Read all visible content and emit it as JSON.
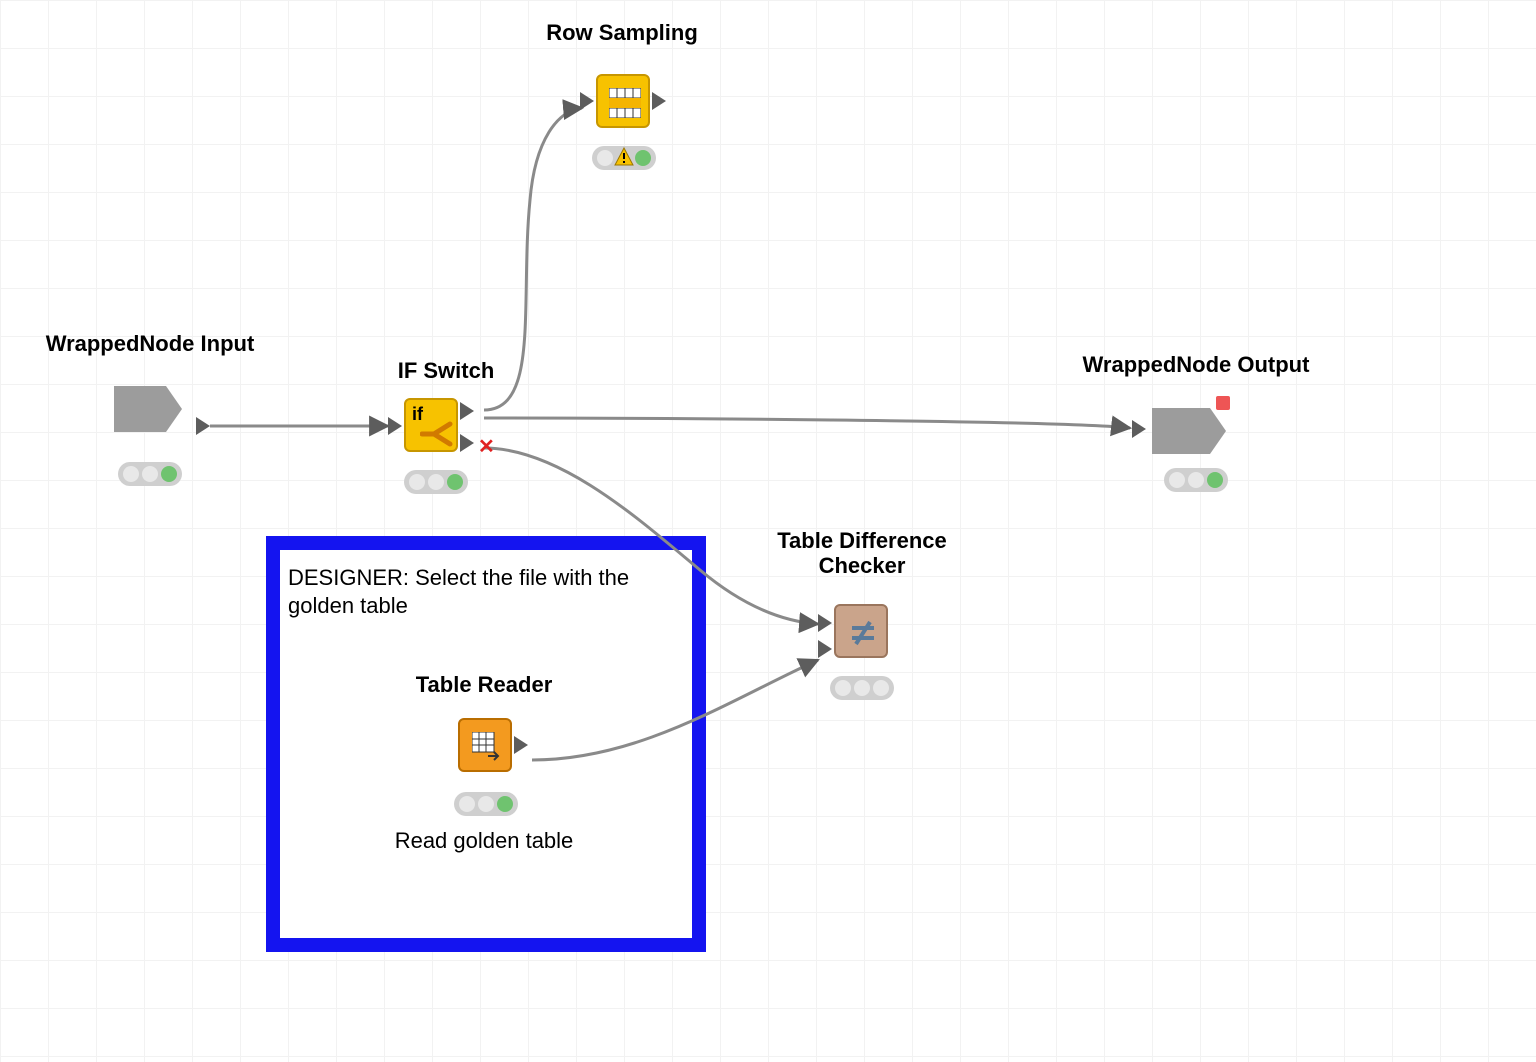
{
  "nodes": {
    "wrapped_input": {
      "label": "WrappedNode Input"
    },
    "if_switch": {
      "label": "IF Switch"
    },
    "row_sampling": {
      "label": "Row Sampling"
    },
    "wrapped_output": {
      "label": "WrappedNode Output"
    },
    "table_reader": {
      "label": "Table Reader",
      "sublabel": "Read golden table"
    },
    "table_diff": {
      "label": "Table Difference\nChecker"
    }
  },
  "annotation": {
    "text": "DESIGNER: Select the file with the\ngolden table"
  },
  "icons": {
    "if_switch_text": "if"
  },
  "colors": {
    "yellow": "#f7c200",
    "orange": "#f39a1f",
    "tan": "#caa48b",
    "gray": "#9c9c9c",
    "annotation_border": "#1414f0"
  }
}
